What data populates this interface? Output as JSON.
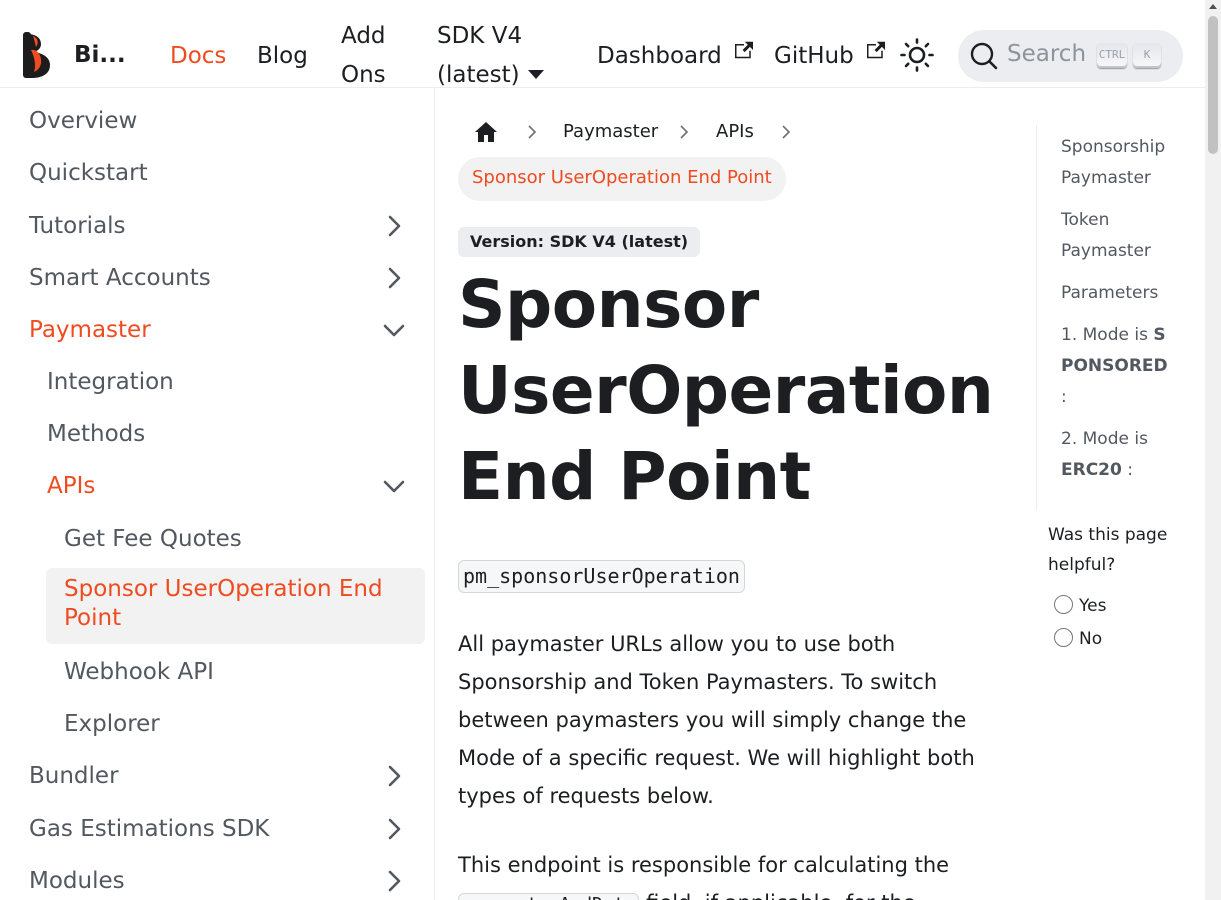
{
  "navbar": {
    "brand": "Bi...",
    "links": {
      "docs": "Docs",
      "blog": "Blog",
      "addons_line1": "Add",
      "addons_line2": "Ons",
      "sdk_line1": "SDK V4",
      "sdk_line2": "(latest)",
      "dashboard": "Dashboard",
      "github": "GitHub"
    },
    "search": {
      "placeholder": "Search",
      "kbd_ctrl": "CTRL",
      "kbd_k": "K"
    }
  },
  "sidebar": {
    "items": [
      {
        "label": "Overview"
      },
      {
        "label": "Quickstart"
      },
      {
        "label": "Tutorials"
      },
      {
        "label": "Smart Accounts"
      },
      {
        "label": "Paymaster"
      },
      {
        "label": "Integration"
      },
      {
        "label": "Methods"
      },
      {
        "label": "APIs"
      },
      {
        "label": "Get Fee Quotes"
      },
      {
        "label": "Sponsor UserOperation End Point"
      },
      {
        "label": "Webhook API"
      },
      {
        "label": "Explorer"
      },
      {
        "label": "Bundler"
      },
      {
        "label": "Gas Estimations SDK"
      },
      {
        "label": "Modules"
      }
    ]
  },
  "breadcrumb": {
    "items": [
      "Paymaster",
      "APIs"
    ],
    "current": "Sponsor UserOperation End Point"
  },
  "main": {
    "version_badge": "Version: SDK V4 (latest)",
    "title_line1": "Sponsor",
    "title_line2": "UserOperation",
    "title_line3": "End Point",
    "method_code": "pm_sponsorUserOperation",
    "paragraph1": "All paymaster URLs allow you to use both Sponsorship and Token Paymasters. To switch between paymasters you will simply change the Mode of a specific request. We will highlight both types of requests below.",
    "paragraph2_prefix": "This endpoint is responsible for calculating the",
    "paragraph2_code": "paymasterAndData",
    "paragraph2_suffix": "field, if applicable, for the"
  },
  "toc": {
    "items": [
      {
        "label": "Sponsorship Paymaster"
      },
      {
        "label": "Token Paymaster"
      },
      {
        "label": "Parameters"
      },
      {
        "prefix": "1. Mode is",
        "bold": "SPONSORED",
        "suffix": ":"
      },
      {
        "prefix": "2. Mode is",
        "bold": "ERC20",
        "suffix": ":"
      }
    ]
  },
  "feedback": {
    "question": "Was this page helpful?",
    "yes": "Yes",
    "no": "No"
  },
  "colors": {
    "accent": "#ef4b20",
    "text": "#1c1e21",
    "muted": "#525860"
  }
}
